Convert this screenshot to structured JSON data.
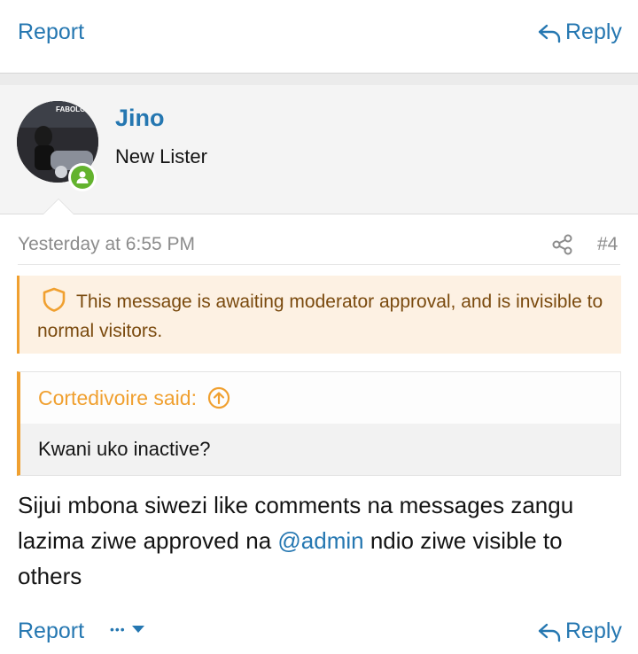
{
  "top_actions": {
    "report": "Report",
    "reply": "Reply"
  },
  "user": {
    "name": "Jino",
    "title": "New Lister",
    "avatar_text": "FABOLOUS"
  },
  "post": {
    "date": "Yesterday at 6:55 PM",
    "number": "#4",
    "moderation_notice": "This message is awaiting moderator approval, and is invisible to normal visitors.",
    "quote_author": "Cortedivoire said:",
    "quote_text": "Kwani uko inactive?",
    "text_before": "Sijui mbona siwezi like comments na messages zangu lazima ziwe approved na ",
    "mention": "@admin",
    "text_after": " ndio ziwe visible to others"
  },
  "bottom_actions": {
    "report": "Report",
    "more": "•••",
    "reply": "Reply"
  },
  "colors": {
    "link": "#2577b1",
    "notice_bg": "#fdf1e3",
    "accent": "#f0a030",
    "online": "#63b32e"
  }
}
